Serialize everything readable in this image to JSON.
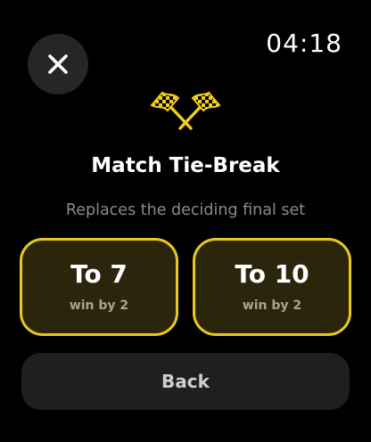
{
  "status_bar": {
    "time": "04:18"
  },
  "header": {
    "close_icon": "close-icon",
    "flag_icon": "checkered-flags-icon"
  },
  "dialog": {
    "title": "Match Tie-Break",
    "subtitle": "Replaces the deciding final set"
  },
  "options": [
    {
      "label": "To 7",
      "sublabel": "win by 2"
    },
    {
      "label": "To 10",
      "sublabel": "win by 2"
    }
  ],
  "actions": {
    "back_label": "Back"
  },
  "colors": {
    "background": "#000000",
    "accent": "#e9c81e",
    "option_fill": "#2b260b",
    "subtitle": "#8a8a8a",
    "button_fill": "#1f1f1f"
  }
}
